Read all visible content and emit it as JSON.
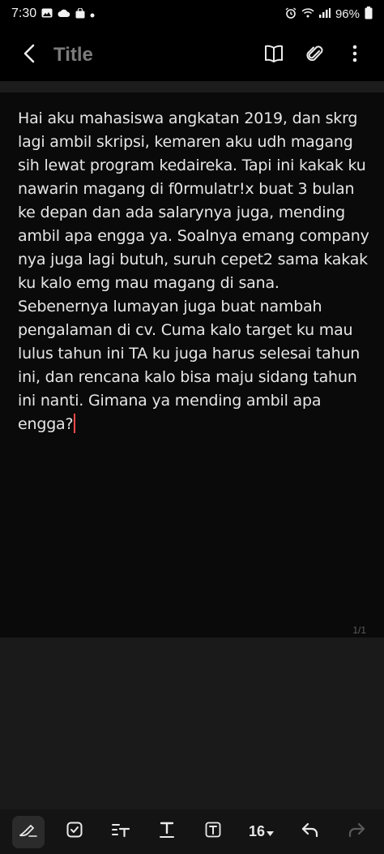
{
  "status": {
    "time": "7:30",
    "battery": "96%",
    "left_icons": [
      "gallery-icon",
      "cloud-icon",
      "shopping-bag-icon",
      "dot-icon"
    ],
    "right_icons": [
      "alarm-icon",
      "wifi-icon",
      "signal-icon",
      "battery-icon"
    ]
  },
  "app_bar": {
    "title": "Title",
    "icons": [
      "back-arrow-icon",
      "book-icon",
      "paperclip-icon",
      "more-vertical-icon"
    ]
  },
  "note": {
    "body": "Hai aku mahasiswa angkatan 2019, dan skrg lagi ambil skripsi, kemaren aku udh magang sih lewat program kedaireka. Tapi ini kakak ku nawarin magang di f0rmulatr!x buat 3 bulan ke depan dan ada salarynya juga, mending ambil apa engga ya. Soalnya emang company nya juga lagi butuh, suruh cepet2 sama kakak ku kalo emg mau magang di sana. Sebenernya lumayan juga buat nambah pengalaman di cv. Cuma kalo target ku mau lulus tahun ini TA ku juga harus selesai tahun ini, dan rencana kalo bisa maju sidang tahun ini nanti. Gimana ya mending ambil apa engga?",
    "page_indicator": "1/1",
    "cursor_color": "#ff4a4a"
  },
  "toolbar": {
    "font_size": "16",
    "icons": [
      "pen-icon",
      "checkbox-icon",
      "text-style-icon",
      "underline-text-icon",
      "text-box-icon",
      "font-size-dropdown",
      "undo-icon",
      "redo-icon"
    ]
  },
  "colors": {
    "background": "#000000",
    "title": "#7b7b7b",
    "text": "#e6e6e6",
    "toolbar": "#141414"
  }
}
